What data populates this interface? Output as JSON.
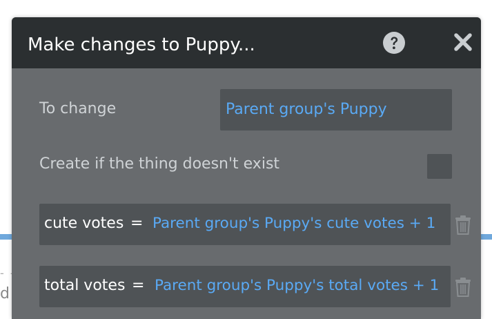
{
  "dialog": {
    "title": "Make changes to Puppy...",
    "help_icon": "question-circle-icon",
    "close_icon": "close-x-icon"
  },
  "to_change": {
    "label": "To change",
    "value": "Parent group's Puppy"
  },
  "create_if_missing": {
    "label": "Create if the thing doesn't exist",
    "checked": false
  },
  "assignments": [
    {
      "field": "cute votes",
      "operator": "=",
      "expression": "Parent group's Puppy's cute votes + 1",
      "delete_icon": "trash-icon"
    },
    {
      "field": "total votes",
      "operator": "=",
      "expression": "Parent group's Puppy's total votes + 1",
      "delete_icon": "trash-icon"
    }
  ],
  "background": {
    "dash_text": "- -",
    "partial_text": "d"
  },
  "colors": {
    "header_bg": "#2b2f31",
    "panel_bg": "#686b6e",
    "field_bg": "#4f5356",
    "link_blue": "#5aaaf5",
    "label_gray": "#cfd3d6"
  }
}
